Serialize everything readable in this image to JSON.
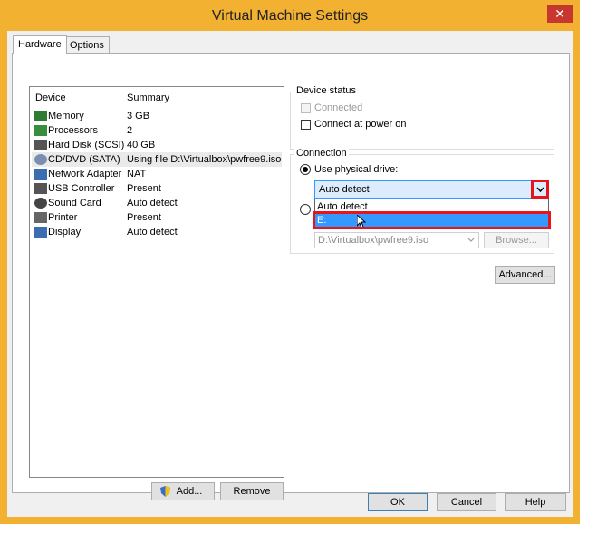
{
  "window": {
    "title": "Virtual Machine Settings",
    "close_glyph": "✕"
  },
  "tabs": [
    {
      "label": "Hardware"
    },
    {
      "label": "Options"
    }
  ],
  "device_list": {
    "headers": {
      "device": "Device",
      "summary": "Summary"
    },
    "rows": [
      {
        "name": "Memory",
        "summary": "3 GB",
        "icon": "memory-icon"
      },
      {
        "name": "Processors",
        "summary": "2",
        "icon": "processor-icon"
      },
      {
        "name": "Hard Disk (SCSI)",
        "summary": "40 GB",
        "icon": "hard-disk-icon"
      },
      {
        "name": "CD/DVD (SATA)",
        "summary": "Using file D:\\Virtualbox\\pwfree9.iso",
        "icon": "cd-dvd-icon",
        "selected": true
      },
      {
        "name": "Network Adapter",
        "summary": "NAT",
        "icon": "network-adapter-icon"
      },
      {
        "name": "USB Controller",
        "summary": "Present",
        "icon": "usb-controller-icon"
      },
      {
        "name": "Sound Card",
        "summary": "Auto detect",
        "icon": "sound-card-icon"
      },
      {
        "name": "Printer",
        "summary": "Present",
        "icon": "printer-icon"
      },
      {
        "name": "Display",
        "summary": "Auto detect",
        "icon": "display-icon"
      }
    ]
  },
  "list_buttons": {
    "add": "Add...",
    "remove": "Remove"
  },
  "device_status": {
    "title": "Device status",
    "connected": {
      "label": "Connected",
      "checked": false,
      "enabled": false
    },
    "connect_at_power_on": {
      "label": "Connect at power on",
      "checked": false
    }
  },
  "connection": {
    "title": "Connection",
    "physical_drive": {
      "label": "Use physical drive:",
      "selected": true
    },
    "drive_select": {
      "value": "Auto detect",
      "options": [
        "Auto detect",
        "E:"
      ],
      "highlighted": "E:"
    },
    "iso_path": "D:\\Virtualbox\\pwfree9.iso",
    "browse": "Browse...",
    "advanced": "Advanced..."
  },
  "footer": {
    "ok": "OK",
    "cancel": "Cancel",
    "help": "Help"
  },
  "colors": {
    "accent": "#f2b130",
    "highlight": "#3399ff",
    "annotation": "#e8141c"
  }
}
